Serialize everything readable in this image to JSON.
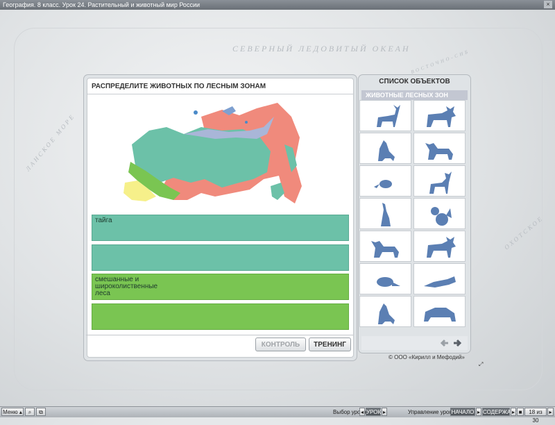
{
  "window": {
    "title": "География. 8 класс. Урок 24. Растительный и животный мир России"
  },
  "background": {
    "ocean_label": "СЕВЕРНЫЙ  ЛЕДОВИТЫЙ  ОКЕАН",
    "sea_left": "ЛАНСКОЕ МОРЕ",
    "sea_right": "ОХОТСКОЕ",
    "note_right": "ВОСТОЧНО-СИБ"
  },
  "main": {
    "title": "РАСПРЕДЕЛИТЕ ЖИВОТНЫХ ПО ЛЕСНЫМ ЗОНАМ",
    "zones": [
      {
        "label": "тайга",
        "color": "#6cc1a8"
      },
      {
        "label": "",
        "color": "#6cc1a8"
      },
      {
        "label": "смешанные и\nшироколиственные\nлеса",
        "color": "#7ac552"
      },
      {
        "label": "",
        "color": "#7ac552"
      }
    ],
    "buttons": {
      "control": "КОНТРОЛЬ",
      "training": "ТРЕНИНГ"
    }
  },
  "side": {
    "title": "СПИСОК ОБЪЕКТОВ",
    "subtitle": "ЖИВОТНЫЕ ЛЕСНЫХ ЗОН",
    "animals": [
      "deer-icon",
      "moose-icon",
      "wolf-icon",
      "lynx-icon",
      "mouse-icon",
      "reindeer-icon",
      "hare-icon",
      "squirrel-icon",
      "lynx-icon",
      "moose-icon",
      "beaver-icon",
      "sable-icon",
      "wolf-icon",
      "bear-icon"
    ]
  },
  "copyright": "© ООО «Кирилл и Мефодий»",
  "bottom": {
    "menu": "Меню",
    "lesson_select": "Выбор урока:",
    "lesson_btn": "УРОК",
    "manage": "Управление уроком:",
    "start": "НАЧАЛО",
    "contents": "СОДЕРЖАНИЕ",
    "page": "18 из 30"
  },
  "colors": {
    "accent": "#5b7fb3",
    "taiga": "#6cc1a8",
    "mixed": "#7ac552",
    "tundra": "#f08a7c",
    "steppe": "#f6f08a"
  }
}
